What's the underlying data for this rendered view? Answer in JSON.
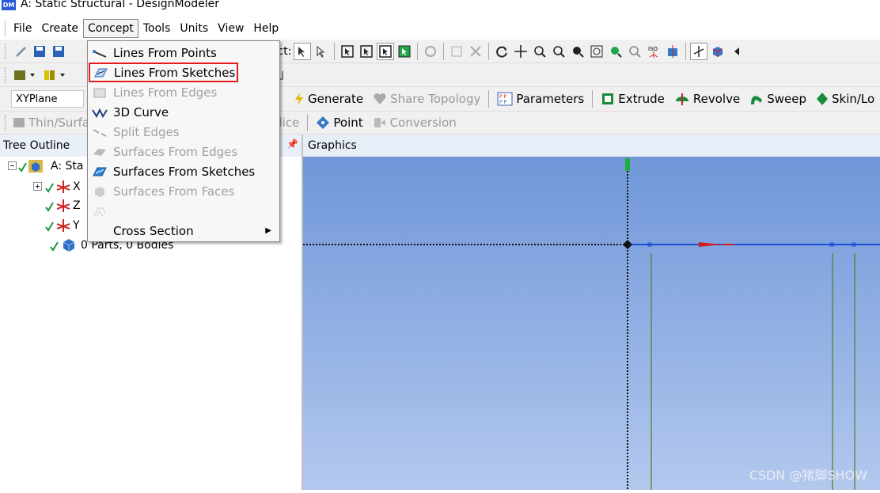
{
  "window": {
    "logo": "DM",
    "title": "A: Static Structural - DesignModeler"
  },
  "menu": {
    "items": [
      "File",
      "Create",
      "Concept",
      "Tools",
      "Units",
      "View",
      "Help"
    ],
    "active": "Concept"
  },
  "toolbar1": {
    "select_label": "lect:"
  },
  "toolbar3": {
    "plane": "XYPlane",
    "generate": "Generate",
    "share_topology": "Share Topology",
    "parameters": "Parameters",
    "extrude": "Extrude",
    "revolve": "Revolve",
    "sweep": "Sweep",
    "skin": "Skin/Lo"
  },
  "toolbar4": {
    "thin": "Thin/Surfa",
    "slice": "Slice",
    "point": "Point",
    "conversion": "Conversion"
  },
  "concept_menu": {
    "items": [
      {
        "label": "Lines From Points",
        "icon": "line-icon",
        "enabled": true
      },
      {
        "label": "Lines From Sketches",
        "icon": "line-sketch-icon",
        "enabled": true,
        "highlighted": true
      },
      {
        "label": "Lines From Edges",
        "icon": "line-edge-icon",
        "enabled": false
      },
      {
        "label": "3D Curve",
        "icon": "curve-icon",
        "enabled": true
      },
      {
        "label": "Split Edges",
        "icon": "split-icon",
        "enabled": false
      },
      {
        "label": "Surfaces From Edges",
        "icon": "surface-edge-icon",
        "enabled": false
      },
      {
        "label": "Surfaces From Sketches",
        "icon": "surface-sketch-icon",
        "enabled": true
      },
      {
        "label": "Surfaces From Faces",
        "icon": "surface-face-icon",
        "enabled": false
      },
      {
        "label": "",
        "icon": "blank-icon",
        "enabled": false
      },
      {
        "label": "Cross Section",
        "icon": "",
        "enabled": true,
        "submenu": true
      }
    ]
  },
  "tree": {
    "header": "Tree Outline",
    "root": "A: Sta",
    "planes": [
      "X",
      "Z",
      "Y"
    ],
    "parts": "0 Parts, 0 Bodies"
  },
  "graphics": {
    "header": "Graphics"
  },
  "watermark": "CSDN @猪脚SHOW",
  "colors": {
    "canvas_top": "#6f96d9",
    "canvas_bottom": "#b3c8ee",
    "highlight": "#e31d1d"
  }
}
